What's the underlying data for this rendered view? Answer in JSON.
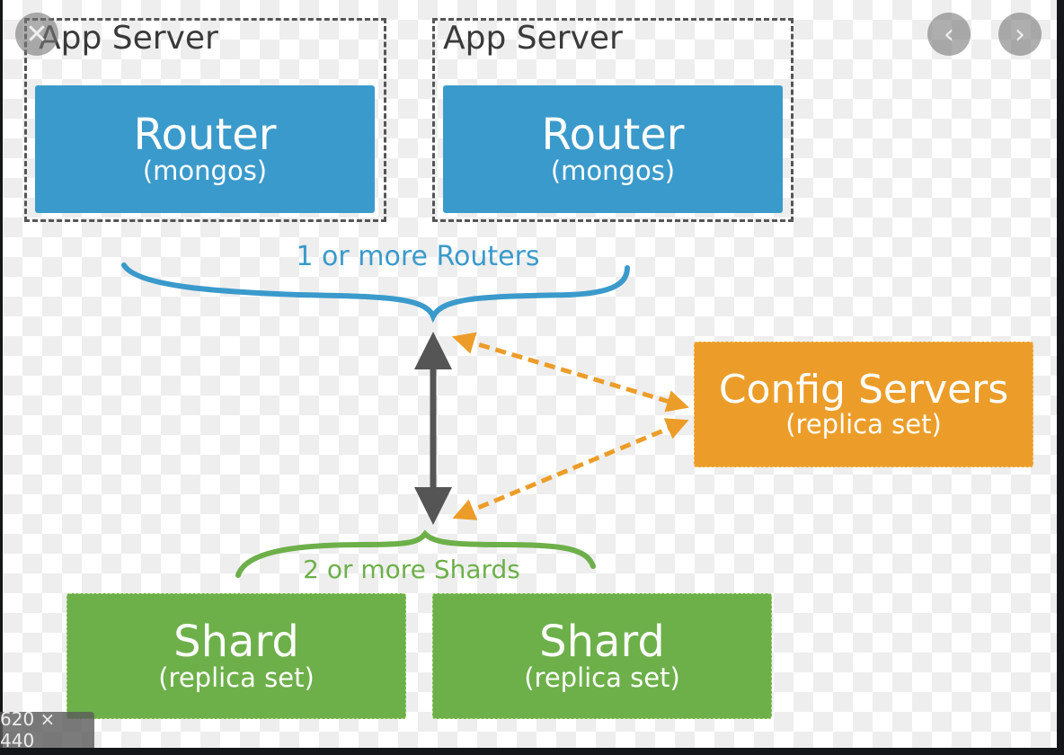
{
  "viewer": {
    "image_size": "620 × 440",
    "close_icon": "close-x-icon",
    "prev_icon": "chevron-left-icon",
    "next_icon": "chevron-right-icon"
  },
  "diagram": {
    "app_servers": [
      {
        "label": "App Server",
        "router_title": "Router",
        "router_sub": "(mongos)"
      },
      {
        "label": "App Server",
        "router_title": "Router",
        "router_sub": "(mongos)"
      }
    ],
    "routers_caption": "1 or more Routers",
    "config": {
      "title": "Config Servers",
      "sub": "(replica set)"
    },
    "shards_caption": "2 or more Shards",
    "shards": [
      {
        "title": "Shard",
        "sub": "(replica set)"
      },
      {
        "title": "Shard",
        "sub": "(replica set)"
      }
    ],
    "colors": {
      "router": "#3a9acb",
      "config": "#ec9d29",
      "shard": "#6db04a",
      "arrow": "#555555"
    }
  }
}
